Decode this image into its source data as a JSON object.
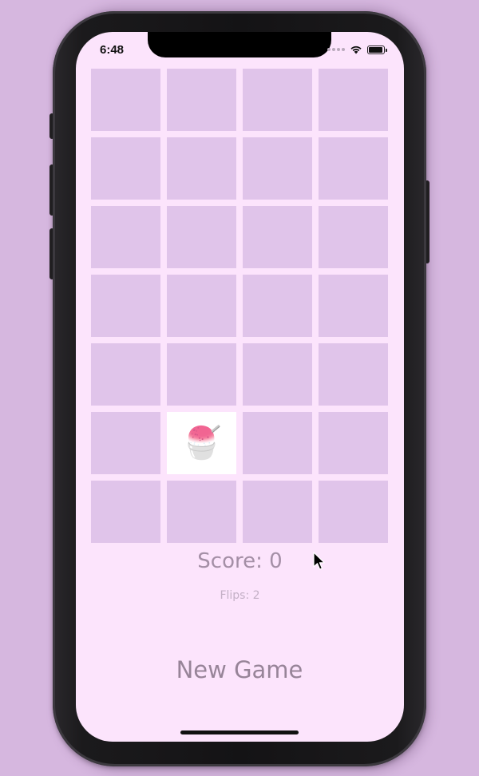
{
  "status_bar": {
    "time": "6:48",
    "battery_level": 0.95,
    "icons": [
      "cellular-dots-icon",
      "wifi-icon",
      "battery-icon"
    ]
  },
  "game": {
    "rows": 7,
    "columns": 4,
    "cards": [
      {
        "face_up": false,
        "emoji": ""
      },
      {
        "face_up": false,
        "emoji": ""
      },
      {
        "face_up": false,
        "emoji": ""
      },
      {
        "face_up": false,
        "emoji": ""
      },
      {
        "face_up": false,
        "emoji": ""
      },
      {
        "face_up": false,
        "emoji": ""
      },
      {
        "face_up": false,
        "emoji": ""
      },
      {
        "face_up": false,
        "emoji": ""
      },
      {
        "face_up": false,
        "emoji": ""
      },
      {
        "face_up": false,
        "emoji": ""
      },
      {
        "face_up": false,
        "emoji": ""
      },
      {
        "face_up": false,
        "emoji": ""
      },
      {
        "face_up": false,
        "emoji": ""
      },
      {
        "face_up": false,
        "emoji": ""
      },
      {
        "face_up": false,
        "emoji": ""
      },
      {
        "face_up": false,
        "emoji": ""
      },
      {
        "face_up": false,
        "emoji": ""
      },
      {
        "face_up": false,
        "emoji": ""
      },
      {
        "face_up": false,
        "emoji": ""
      },
      {
        "face_up": false,
        "emoji": ""
      },
      {
        "face_up": false,
        "emoji": ""
      },
      {
        "face_up": true,
        "emoji": "🍧"
      },
      {
        "face_up": false,
        "emoji": ""
      },
      {
        "face_up": false,
        "emoji": ""
      },
      {
        "face_up": false,
        "emoji": ""
      },
      {
        "face_up": false,
        "emoji": ""
      },
      {
        "face_up": false,
        "emoji": ""
      },
      {
        "face_up": false,
        "emoji": ""
      }
    ],
    "score_text": "Score: 0",
    "flips_text": "Flips: 2",
    "new_game_label": "New Game"
  },
  "colors": {
    "background": "#d6b7df",
    "screen": "#fce4fc",
    "card_back": "#e0c4ea",
    "card_face": "#ffffff",
    "score_text": "#a48fa6",
    "flips_text": "#c4b0c6",
    "button_text": "#978498"
  }
}
